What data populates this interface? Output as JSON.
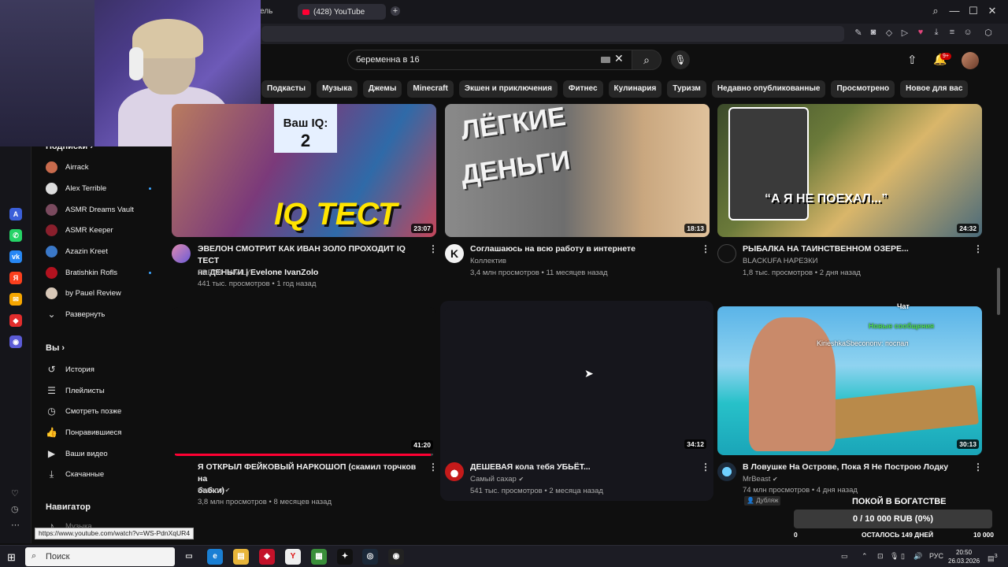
{
  "browser": {
    "prev_tab_fragment": "ель",
    "tab_title": "(428) YouTube",
    "new_tab": "+",
    "controls": [
      "⌕",
      "—",
      "☐",
      "✕"
    ],
    "status_url": "https://www.youtube.com/watch?v=WS-PdnXqUR4"
  },
  "header": {
    "search_value": "беременна в 16",
    "notification_badge": "9+"
  },
  "chips": [
    "Подкасты",
    "Музыка",
    "Джемы",
    "Minecraft",
    "Экшен и приключения",
    "Фитнес",
    "Кулинария",
    "Туризм",
    "Недавно опубликованные",
    "Просмотрено",
    "Новое для вас"
  ],
  "sidebar": {
    "subs_heading": "Подписки",
    "subscriptions": [
      {
        "name": "Airrack",
        "color": "#c96b4d",
        "dot": false
      },
      {
        "name": "Alex Terrible",
        "color": "#dddddd",
        "dot": true
      },
      {
        "name": "ASMR Dreams Vault",
        "color": "#7a4a5e",
        "dot": false
      },
      {
        "name": "ASMR Keeper",
        "color": "#8a1f2c",
        "dot": false
      },
      {
        "name": "Azazin Kreet",
        "color": "#3a78c8",
        "dot": false
      },
      {
        "name": "Bratishkin Rofls",
        "color": "#b3121f",
        "dot": true
      },
      {
        "name": "by Pauel Review",
        "color": "#d8c8b8",
        "dot": false
      }
    ],
    "expand_label": "Развернуть",
    "you_heading": "Вы",
    "you_items": [
      {
        "label": "История",
        "icon": "history-icon"
      },
      {
        "label": "Плейлисты",
        "icon": "playlists-icon"
      },
      {
        "label": "Смотреть позже",
        "icon": "watch-later-icon"
      },
      {
        "label": "Понравившиеся",
        "icon": "like-icon"
      },
      {
        "label": "Ваши видео",
        "icon": "your-videos-icon"
      },
      {
        "label": "Скачанные",
        "icon": "download-icon"
      }
    ],
    "navigator_heading": "Навигатор",
    "navigator_first": "Музыка"
  },
  "videos": [
    {
      "title_1": "ЭВЕЛОН СМОТРИТ КАК ИВАН ЗОЛО ПРОХОДИТ IQ ТЕСТ",
      "title_2": "на ДЕНЬГИ | Evelone IvanZolo",
      "channel": "FREAK FAMILY",
      "stats": "441 тыс. просмотров • 1 год назад",
      "duration": "23:07",
      "thumb_text_1": "Ваш IQ:",
      "thumb_text_2": "2",
      "thumb_text_3": "IQ ТЕСТ"
    },
    {
      "title_1": "Соглашаюсь на всю работу в интернете",
      "title_2": "",
      "channel": "Коллектив",
      "stats": "3,4 млн просмотров • 11 месяцев назад",
      "duration": "18:13",
      "thumb_text_1": "ЛЁГКИЕ",
      "thumb_text_2": "ДЕНЬГИ",
      "channel_letter": "K"
    },
    {
      "title_1": "РЫБАЛКА НА ТАИНСТВЕННОМ ОЗЕРЕ...",
      "title_2": "",
      "channel": "BLACKUFA НАРЕЗКИ",
      "stats": "1,8 тыс. просмотров • 2 дня назад",
      "duration": "24:32",
      "thumb_text_1": "“А Я НЕ ПОЕХАЛ...”"
    },
    {
      "title_1": "Я ОТКРЫЛ ФЕЙКОВЫЙ НАРКОШОП (скамил торчков на",
      "title_2": "бабки)",
      "channel": "кэшзло",
      "stats": "3,8 млн просмотров • 8 месяцев назад",
      "duration": "41:20",
      "progress": 0.99
    },
    {
      "title_1": "ДЕШЕВАЯ кола тебя УБЬЁТ...",
      "title_2": "",
      "channel": "Самый сахар",
      "stats": "541 тыс. просмотров • 2 месяца назад",
      "duration": "34:12"
    },
    {
      "title_1": "В Ловушке На Острове, Пока Я Не Построю Лодку",
      "title_2": "",
      "channel": "MrBeast",
      "stats": "74 млн просмотров • 4 дня назад",
      "duration": "30:13",
      "badge": "Дубляж"
    }
  ],
  "chat": {
    "title": "Чат",
    "line_1": "Новые сообщения",
    "line_2": "KirieshkaSbecononv: поспал"
  },
  "goal": {
    "title": "ПОКОЙ В БОГАТСТВЕ",
    "progress_text": "0 / 10 000 RUB (0%)",
    "progress": 0,
    "min": "0",
    "remaining": "ОСТАЛОСЬ 149 ДНЕЙ",
    "max": "10 000"
  },
  "taskbar": {
    "search_label": "Поиск",
    "lang": "РУС",
    "time": "20:50",
    "date": "26.03.2026",
    "notif_count": "3"
  }
}
